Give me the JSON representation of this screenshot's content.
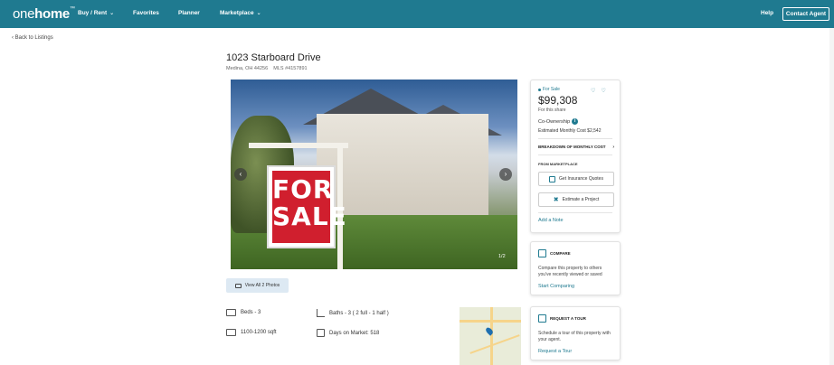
{
  "header": {
    "logo_prefix": "one",
    "logo_bold": "home",
    "logo_tm": "™",
    "nav": [
      {
        "label": "Buy / Rent",
        "has_dropdown": true
      },
      {
        "label": "Favorites",
        "has_dropdown": false
      },
      {
        "label": "Planner",
        "has_dropdown": false
      },
      {
        "label": "Marketplace",
        "has_dropdown": true
      }
    ],
    "help_label": "Help",
    "contact_label": "Contact Agent"
  },
  "back_label": "Back to Listings",
  "listing": {
    "address": "1023 Starboard Drive",
    "subline": "Medina, OH 44256    MLS #4157891",
    "photo_count": "1/2",
    "sign_line1": "FOR",
    "sign_line2": "SALE",
    "view_all_label": "View All 2 Photos",
    "beds": "Beds - 3",
    "baths": "Baths - 3 ( 2 full - 1 half )",
    "sqft": "1100-1200 sqft",
    "days": "Days on Market: 518"
  },
  "price_card": {
    "status": "For Sale",
    "price": "$99,308",
    "share_text": "For this share",
    "coownership": "Co-Ownership",
    "est_cost": "Estimated Monthly Cost $2,542",
    "breakdown_label": "BREAKDOWN OF MONTHLY COST",
    "from_marketplace": "FROM MARKETPLACE",
    "insurance_label": "Get Insurance Quotes",
    "estimate_label": "Estimate a Project",
    "add_note": "Add a Note"
  },
  "compare_card": {
    "title": "COMPARE",
    "text": "Compare this property to others you've recently viewed or saved",
    "link": "Start Comparing"
  },
  "tour_card": {
    "title": "REQUEST A TOUR",
    "text": "Schedule a tour of this property with your agent.",
    "link": "Request a Tour"
  },
  "colors": {
    "brand": "#1f7a90",
    "sign_red": "#d01f2e"
  }
}
